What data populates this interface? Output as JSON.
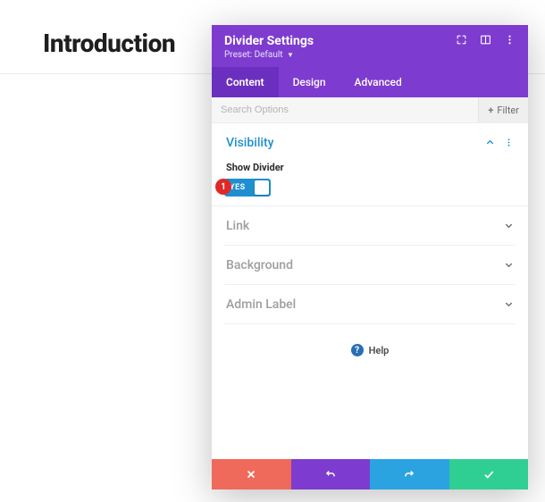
{
  "page": {
    "heading": "Introduction"
  },
  "panel": {
    "title": "Divider Settings",
    "preset_label": "Preset:",
    "preset_value": "Default",
    "tabs": {
      "content": "Content",
      "design": "Design",
      "advanced": "Advanced"
    },
    "search": {
      "placeholder": "Search Options"
    },
    "filter_label": "Filter",
    "sections": {
      "visibility": {
        "title": "Visibility",
        "show_divider_label": "Show Divider",
        "toggle_text": "YES",
        "badge_number": "1"
      },
      "link": "Link",
      "background": "Background",
      "admin_label": "Admin Label"
    },
    "help_label": "Help"
  }
}
